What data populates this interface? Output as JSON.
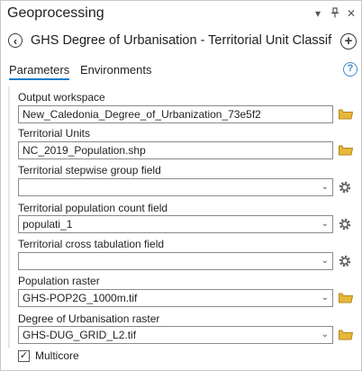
{
  "pane": {
    "title": "Geoprocessing",
    "tool_title": "GHS Degree of Urbanisation - Territorial Unit Classification"
  },
  "titlebar_icons": {
    "dropdown": "chevron-down-icon",
    "pin": "pin-icon",
    "close": "close-icon"
  },
  "toolbar": {
    "back_glyph": "‹",
    "add_glyph": "+"
  },
  "tabs": {
    "parameters": "Parameters",
    "environments": "Environments"
  },
  "help": {
    "glyph": "?"
  },
  "params": {
    "output_workspace": {
      "label": "Output workspace",
      "value": "New_Caledonia_Degree_of_Urbanization_73e5f2"
    },
    "territorial_units": {
      "label": "Territorial Units",
      "value": "NC_2019_Population.shp"
    },
    "stepwise_group": {
      "label": "Territorial stepwise group field",
      "value": ""
    },
    "pop_count": {
      "label": "Territorial population count field",
      "value": "populati_1"
    },
    "cross_tab": {
      "label": "Territorial cross tabulation field",
      "value": ""
    },
    "pop_raster": {
      "label": "Population raster",
      "value": "GHS-POP2G_1000m.tif"
    },
    "dou_raster": {
      "label": "Degree of Urbanisation raster",
      "value": "GHS-DUG_GRID_L2.tif"
    }
  },
  "multicore": {
    "label": "Multicore",
    "checked": true,
    "check_glyph": "✓"
  },
  "colors": {
    "accent": "#1f7ec9",
    "folder": "#e7b73c",
    "help": "#3f8ad0"
  }
}
